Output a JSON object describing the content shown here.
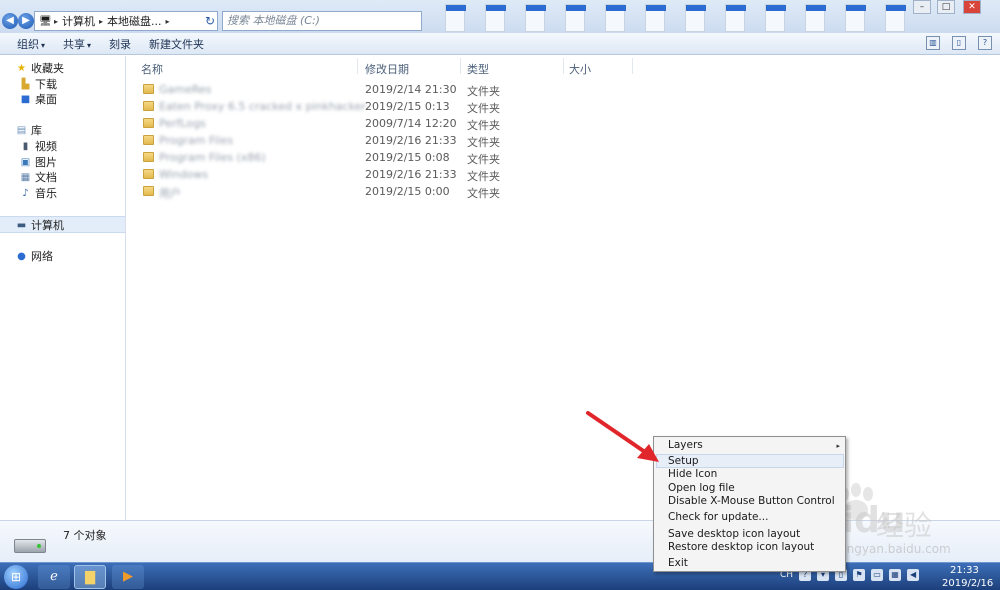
{
  "address": {
    "crumbs": [
      "计算机",
      "本地磁盘..."
    ],
    "search_placeholder": "搜索 本地磁盘 (C:)"
  },
  "toolbar": {
    "organize": "组织",
    "share": "共享",
    "burn": "刻录",
    "new_folder": "新建文件夹"
  },
  "nav": {
    "favorites": "收藏夹",
    "downloads": "下载",
    "desktop": "桌面",
    "libraries": "库",
    "videos": "视频",
    "pictures": "图片",
    "documents": "文档",
    "music": "音乐",
    "computer": "计算机",
    "network": "网络"
  },
  "columns": {
    "name": "名称",
    "modified": "修改日期",
    "type": "类型",
    "size": "大小"
  },
  "files": [
    {
      "name": "GameRes",
      "date": "2019/2/14 21:30",
      "type": "文件夹"
    },
    {
      "name": "Eaten Proxy 6.5 cracked x pinkhacker",
      "date": "2019/2/15 0:13",
      "type": "文件夹"
    },
    {
      "name": "PerfLogs",
      "date": "2009/7/14 12:20",
      "type": "文件夹"
    },
    {
      "name": "Program Files",
      "date": "2019/2/16 21:33",
      "type": "文件夹"
    },
    {
      "name": "Program Files (x86)",
      "date": "2019/2/15 0:08",
      "type": "文件夹"
    },
    {
      "name": "Windows",
      "date": "2019/2/16 21:33",
      "type": "文件夹"
    },
    {
      "name": "用户",
      "date": "2019/2/15 0:00",
      "type": "文件夹"
    }
  ],
  "details": {
    "count": "7 个对象"
  },
  "menu": {
    "items": [
      "Layers",
      "Setup",
      "Hide Icon",
      "Open log file",
      "Disable X-Mouse Button Control",
      "Check for update...",
      "Save desktop icon layout",
      "Restore desktop icon layout",
      "Exit"
    ]
  },
  "taskbar": {
    "lang": "CH",
    "time": "21:33",
    "date": "2019/2/16"
  },
  "watermark": {
    "brand": "Baidu",
    "cn": "经验",
    "url": "jingyan.baidu.com"
  },
  "colors": {
    "accent": "#2c6bd1",
    "annotation_arrow": "#e0262a",
    "taskbar": "#1c3f7a"
  }
}
